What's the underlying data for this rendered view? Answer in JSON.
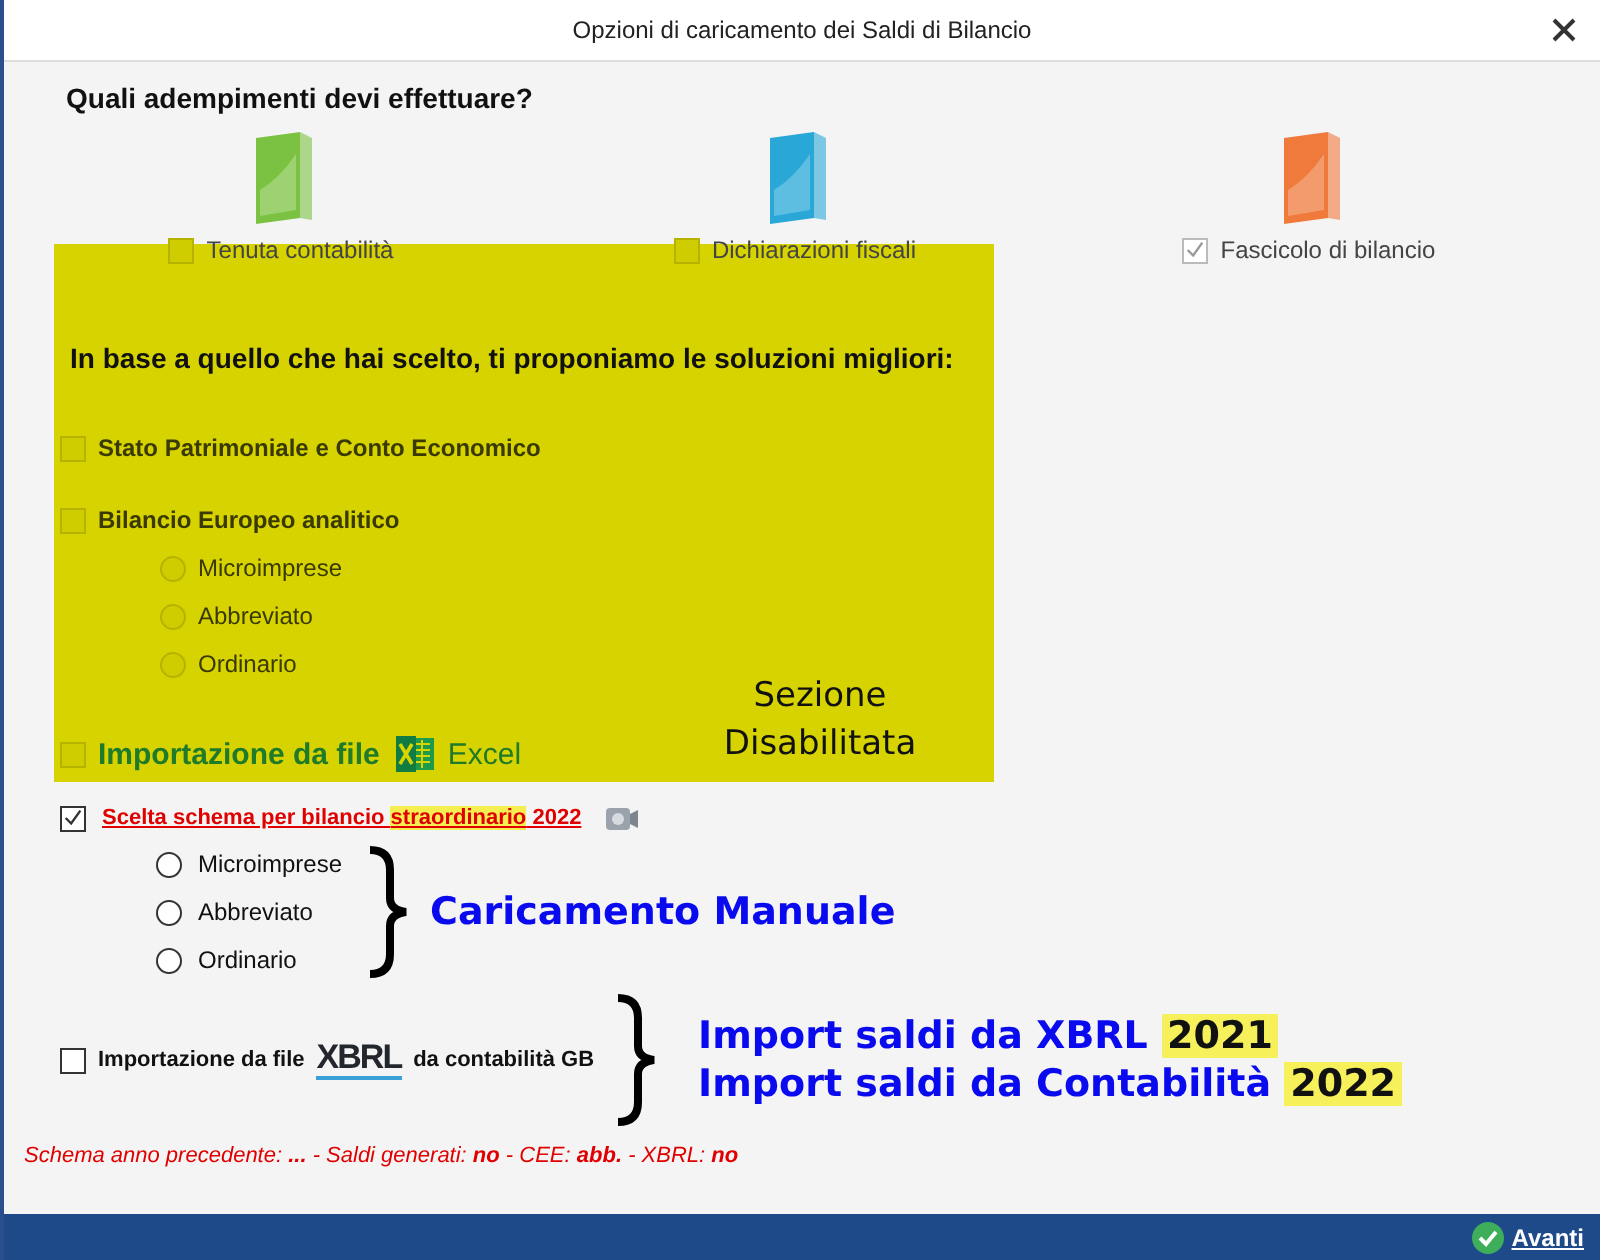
{
  "window": {
    "title": "Opzioni di caricamento dei Saldi di Bilancio"
  },
  "question": "Quali adempimenti devi effettuare?",
  "products": [
    {
      "label": "Tenuta contabilità",
      "checked": false,
      "color": "#7cc242"
    },
    {
      "label": "Dichiarazioni fiscali",
      "checked": false,
      "color": "#29a8d8"
    },
    {
      "label": "Fascicolo di bilancio",
      "checked": true,
      "color": "#f07a3c"
    }
  ],
  "disabled_section": {
    "label": "Sezione Disabilitata",
    "heading": "In base a quello che hai scelto, ti proponiamo le soluzioni migliori:",
    "options": [
      {
        "kind": "checkbox",
        "label": "Stato Patrimoniale e Conto Economico",
        "checked": false
      },
      {
        "kind": "checkbox",
        "label": "Bilancio Europeo analitico",
        "checked": false
      },
      {
        "kind": "radio",
        "label": "Microimprese",
        "selected": false
      },
      {
        "kind": "radio",
        "label": "Abbreviato",
        "selected": false
      },
      {
        "kind": "radio",
        "label": "Ordinario",
        "selected": false
      },
      {
        "kind": "excel",
        "label": "Importazione da file",
        "brand": "Excel",
        "checked": false
      }
    ]
  },
  "scheme": {
    "checked": true,
    "parts": [
      {
        "text": "Scelta schema per bilancio ",
        "highlighted": false
      },
      {
        "text": "straordinario",
        "highlighted": true
      },
      {
        "text": " 2022",
        "highlighted": false
      }
    ]
  },
  "manual_options": [
    {
      "label": "Microimprese",
      "selected": false
    },
    {
      "label": "Abbreviato",
      "selected": false
    },
    {
      "label": "Ordinario",
      "selected": false
    }
  ],
  "manual_note": "Caricamento Manuale",
  "xbrl_import": {
    "checked": false,
    "label_before": "Importazione da file",
    "logo": "XBRL",
    "label_after": "da contabilità GB"
  },
  "import_notes": [
    {
      "text": "Import saldi da XBRL ",
      "year": "2021"
    },
    {
      "text": "Import saldi da Contabilità ",
      "year": "2022"
    }
  ],
  "status_line": "Schema anno precedente: **...** - Saldi generati: **no** - CEE: **abb.** - XBRL: **no**",
  "footer": {
    "next": "Avanti"
  }
}
